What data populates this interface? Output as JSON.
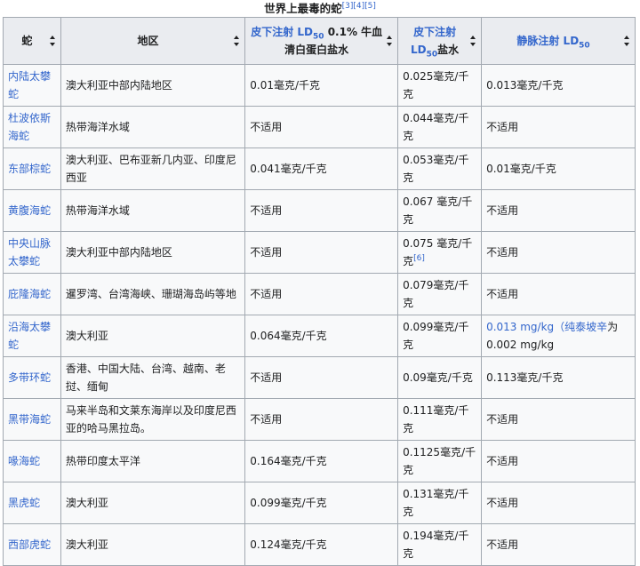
{
  "caption": {
    "title": "世界上最毒的蛇",
    "refs": [
      "[3]",
      "[4]",
      "[5]"
    ]
  },
  "headers": {
    "snake": "蛇",
    "region": "地区",
    "sc1_link": "皮下注射 LD",
    "sc1_sub": "50",
    "sc1_rest": " 0.1% 牛血清白蛋白盐水",
    "sc2_link": "皮下注射 LD",
    "sc2_sub": "50",
    "sc2_rest": "盐水",
    "iv_link": "静脉注射 LD",
    "iv_sub": "50"
  },
  "rows": [
    {
      "snake": "内陆太攀蛇",
      "region": "澳大利亚中部内陆地区",
      "sc1": "0.01毫克/千克",
      "sc2": "0.025毫克/千克",
      "iv": "0.013毫克/千克"
    },
    {
      "snake": "杜波依斯海蛇",
      "region": "热带海洋水域",
      "sc1": "不适用",
      "sc2": "0.044毫克/千克",
      "iv": "不适用"
    },
    {
      "snake": "东部棕蛇",
      "region": "澳大利亚、巴布亚新几内亚、印度尼西亚",
      "sc1": "0.041毫克/千克",
      "sc2": "0.053毫克/千克",
      "iv": "0.01毫克/千克"
    },
    {
      "snake": "黄腹海蛇",
      "region": "热带海洋水域",
      "sc1": "不适用",
      "sc2": "0.067 毫克/千克",
      "iv": "不适用"
    },
    {
      "snake": "中央山脉太攀蛇",
      "region": "澳大利亚中部内陆地区",
      "sc1": "不适用",
      "sc2": "0.075 毫克/千克",
      "sc2_ref": "[6]",
      "iv": "不适用"
    },
    {
      "snake": "庇隆海蛇",
      "region": "暹罗湾、台湾海峡、珊瑚海岛屿等地",
      "sc1": "不适用",
      "sc2": "0.079毫克/千克",
      "iv": "不适用"
    },
    {
      "snake": "沿海太攀蛇",
      "region": "澳大利亚",
      "sc1": "0.064毫克/千克",
      "sc2": "0.099毫克/千克",
      "iv_link": "0.013 mg/kg（纯泰坡辛",
      "iv_rest": "为0.002 mg/kg"
    },
    {
      "snake": "多带环蛇",
      "region": "香港、中国大陆、台湾、越南、老挝、缅甸",
      "sc1": "不适用",
      "sc2": "0.09毫克/千克",
      "iv": "0.113毫克/千克"
    },
    {
      "snake": "黑带海蛇",
      "region": "马来半岛和文莱东海岸以及印度尼西亚的哈马黑拉岛。",
      "sc1": "不适用",
      "sc2": "0.111毫克/千克",
      "iv": "不适用"
    },
    {
      "snake": "喙海蛇",
      "region": "热带印度太平洋",
      "sc1": "0.164毫克/千克",
      "sc2": "0.1125毫克/千克",
      "iv": "不适用"
    },
    {
      "snake": "黑虎蛇",
      "region": "澳大利亚",
      "sc1": "0.099毫克/千克",
      "sc2": "0.131毫克/千克",
      "iv": "不适用"
    },
    {
      "snake": "西部虎蛇",
      "region": "澳大利亚",
      "sc1": "0.124毫克/千克",
      "sc2": "0.194毫克/千克",
      "iv": "不适用"
    }
  ]
}
